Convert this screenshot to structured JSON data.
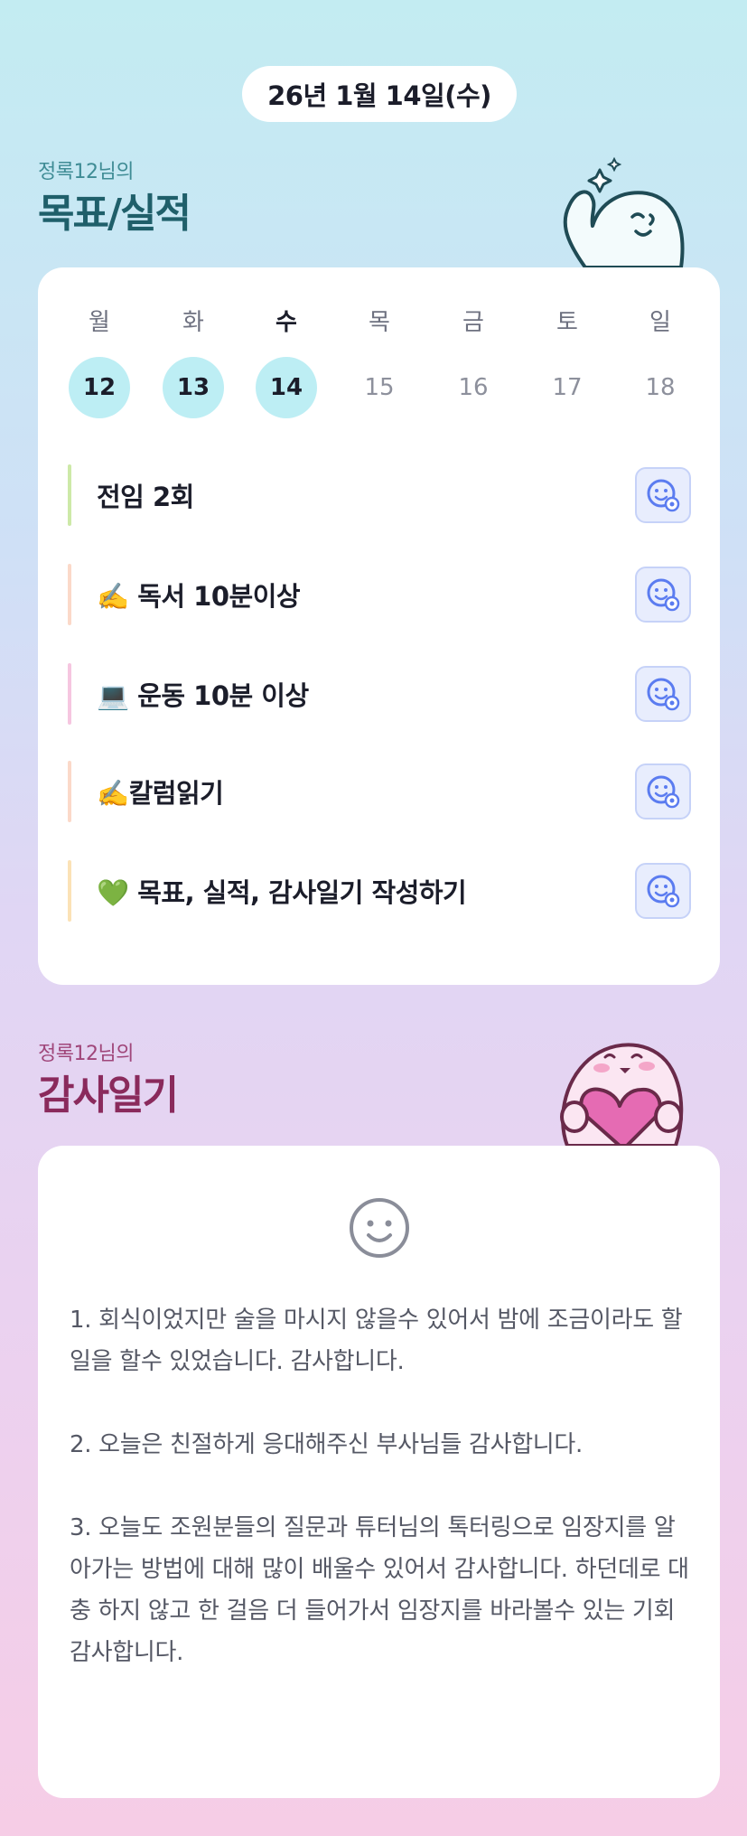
{
  "header": {
    "date": "26년 1월 14일(수)"
  },
  "goals_section": {
    "subtitle": "정록12님의",
    "title": "목표/실적"
  },
  "week": {
    "days": [
      {
        "label": "월",
        "date": "12",
        "done": true,
        "today": false
      },
      {
        "label": "화",
        "date": "13",
        "done": true,
        "today": false
      },
      {
        "label": "수",
        "date": "14",
        "done": true,
        "today": true
      },
      {
        "label": "목",
        "date": "15",
        "done": false,
        "today": false
      },
      {
        "label": "금",
        "date": "16",
        "done": false,
        "today": false
      },
      {
        "label": "토",
        "date": "17",
        "done": false,
        "today": false
      },
      {
        "label": "일",
        "date": "18",
        "done": false,
        "today": false
      }
    ]
  },
  "goals": [
    {
      "text": "전임 2회",
      "bar_color": "#cde9a8"
    },
    {
      "text": "✍️ 독서 10분이상",
      "bar_color": "#fbd9c9"
    },
    {
      "text": "💻 운동 10분 이상",
      "bar_color": "#f6c6e0"
    },
    {
      "text": "✍️칼럼읽기",
      "bar_color": "#fbd9c9"
    },
    {
      "text": "💚 목표, 실적, 감사일기 작성하기",
      "bar_color": "#fbe2b6"
    }
  ],
  "diary_section": {
    "subtitle": "정록12님의",
    "title": "감사일기"
  },
  "diary": {
    "mood_icon": "smile-face-icon",
    "entries": [
      "1. 회식이었지만 술을 마시지 않을수 있어서 밤에 조금이라도 할일을 할수 있었습니다. 감사합니다.",
      "2. 오늘은 친절하게 응대해주신 부사님들 감사합니다.",
      "3. 오늘도 조원분들의 질문과 튜터님의 톡터링으로 임장지를 알아가는 방법에 대해 많이 배울수 있어서 감사합니다. 하던데로 대충 하지 않고 한 걸음 더 들어가서 임장지를 바라볼수 있는 기회 감사합니다."
    ]
  },
  "colors": {
    "goals_title": "#1f5f6a",
    "goals_subtitle": "#3f8c95",
    "diary_title": "#8a2a5c",
    "diary_subtitle": "#a0467a",
    "done_circle": "#bdeef4",
    "reaction_icon": "#5b7cf0"
  }
}
